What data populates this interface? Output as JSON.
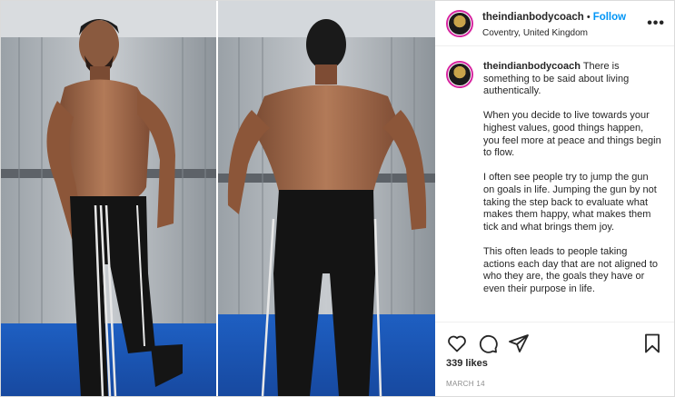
{
  "post": {
    "username": "theindianbodycoach",
    "follow_label": "Follow",
    "separator": "•",
    "location": "Coventry, United Kingdom",
    "more_label": "•••",
    "caption_username": "theindianbodycoach",
    "caption_paragraphs": [
      "There is something to be said about living authentically.",
      "When you decide to live towards your highest values, good things happen, you feel more at peace and things begin to flow.",
      "I often see people try to jump the gun on goals in life. Jumping the gun by not taking the step back to evaluate what makes them happy, what makes them tick and what brings them joy.",
      "This often leads to people taking actions each day that are not aligned to who they are, the goals they have or even their purpose in life."
    ],
    "likes": "339 likes",
    "date": "MARCH 14"
  },
  "icons": {
    "like": "heart-icon",
    "comment": "comment-icon",
    "share": "share-icon",
    "save": "bookmark-icon",
    "more": "more-options-icon"
  },
  "colors": {
    "follow": "#0095f6",
    "text": "#262626",
    "muted": "#8e8e8e",
    "border": "#dbdbdb",
    "avatar_ring": "#d6249f"
  }
}
